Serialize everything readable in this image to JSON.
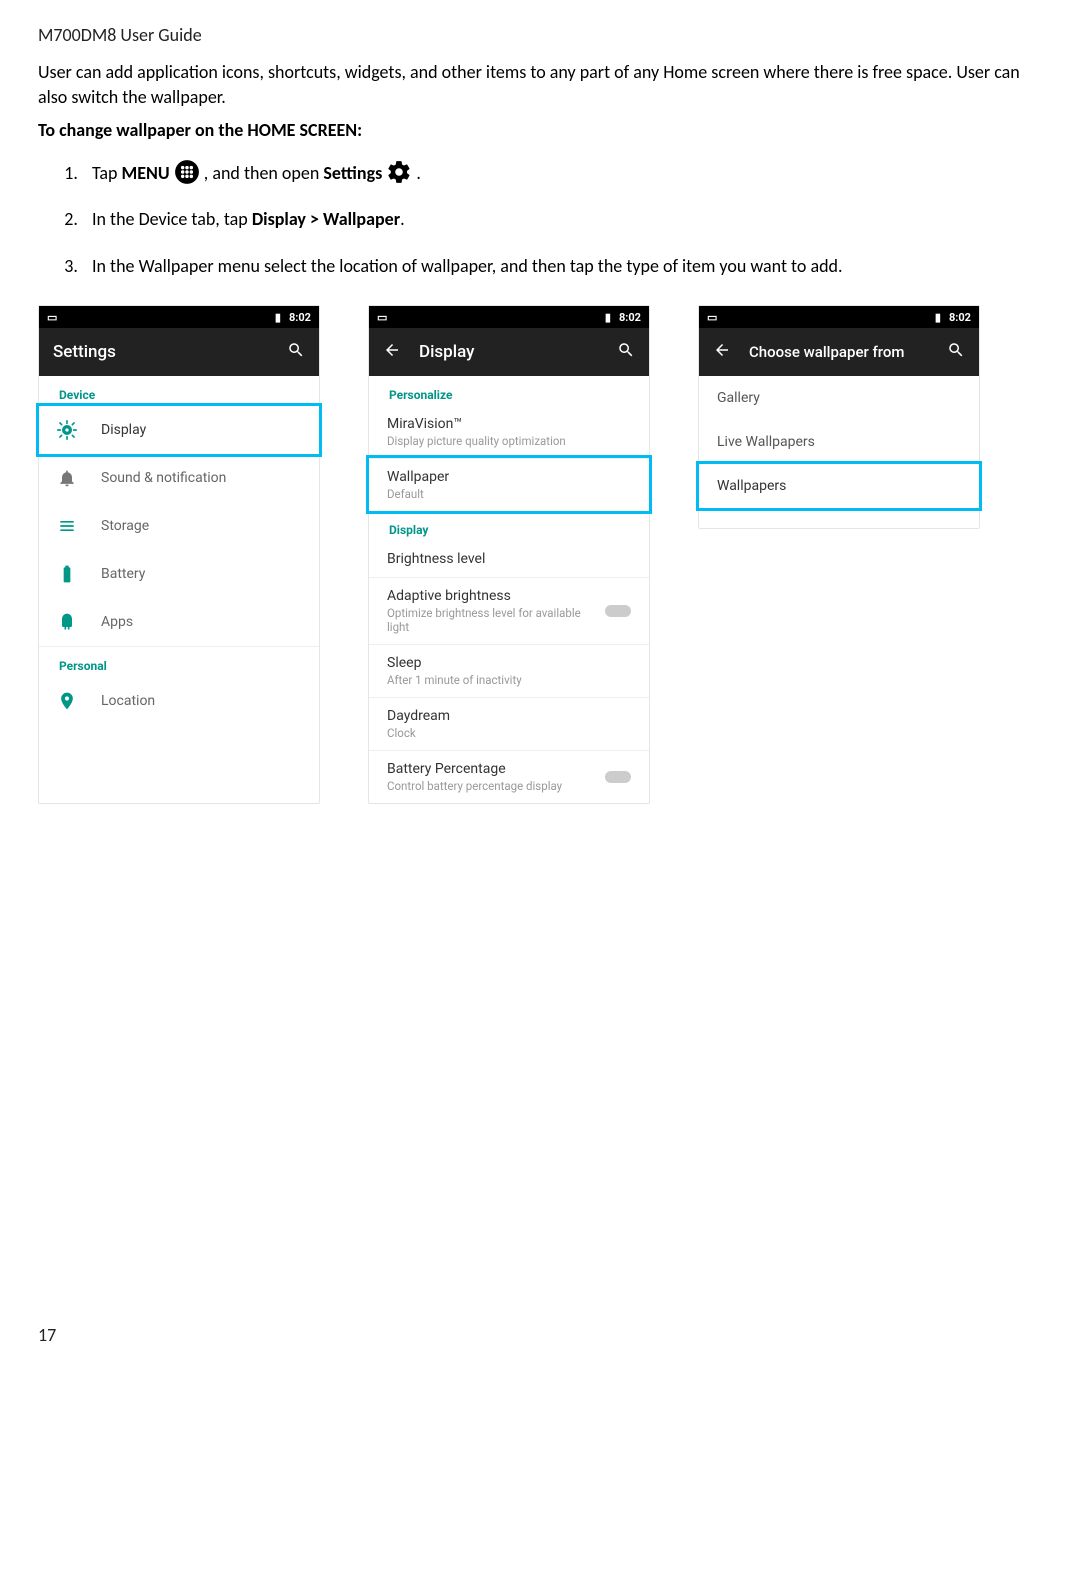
{
  "header": {
    "title": "M700DM8 User Guide"
  },
  "intro": "User can add application icons, shortcuts, widgets, and other items to any part of any Home screen where there is free space. User can also switch the wallpaper.",
  "heading": "To change wallpaper on the HOME SCREEN:",
  "steps": {
    "s1_a": "Tap ",
    "s1_menu": "MENU",
    "s1_b": " , and then open ",
    "s1_settings": "Settings",
    "s1_c": " .",
    "s2": "In the Device tab, tap ",
    "s2_b": "Display > Wallpaper",
    "s2_c": ".",
    "s3": "In the Wallpaper menu select the location of wallpaper, and then tap the type of item you want to add."
  },
  "shot1": {
    "status_time": "8:02",
    "appbar_title": "Settings",
    "section_device": "Device",
    "items": {
      "display": "Display",
      "sound": "Sound & notification",
      "storage": "Storage",
      "battery": "Battery",
      "apps": "Apps"
    },
    "section_personal": "Personal",
    "location": "Location"
  },
  "shot2": {
    "status_time": "8:02",
    "appbar_title": "Display",
    "sec_personalize": "Personalize",
    "mira_title": "MiraVision™",
    "mira_sub": "Display picture quality optimization",
    "wall_title": "Wallpaper",
    "wall_sub": "Default",
    "sec_display": "Display",
    "bright": "Brightness level",
    "adapt_title": "Adaptive brightness",
    "adapt_sub": "Optimize brightness level for available light",
    "sleep_title": "Sleep",
    "sleep_sub": "After 1 minute of inactivity",
    "day_title": "Daydream",
    "day_sub": "Clock",
    "batt_title": "Battery Percentage",
    "batt_sub": "Control battery percentage display"
  },
  "shot3": {
    "status_time": "8:02",
    "appbar_title": "Choose wallpaper from",
    "gallery": "Gallery",
    "live": "Live Wallpapers",
    "wallpapers": "Wallpapers"
  },
  "page_number": "17"
}
